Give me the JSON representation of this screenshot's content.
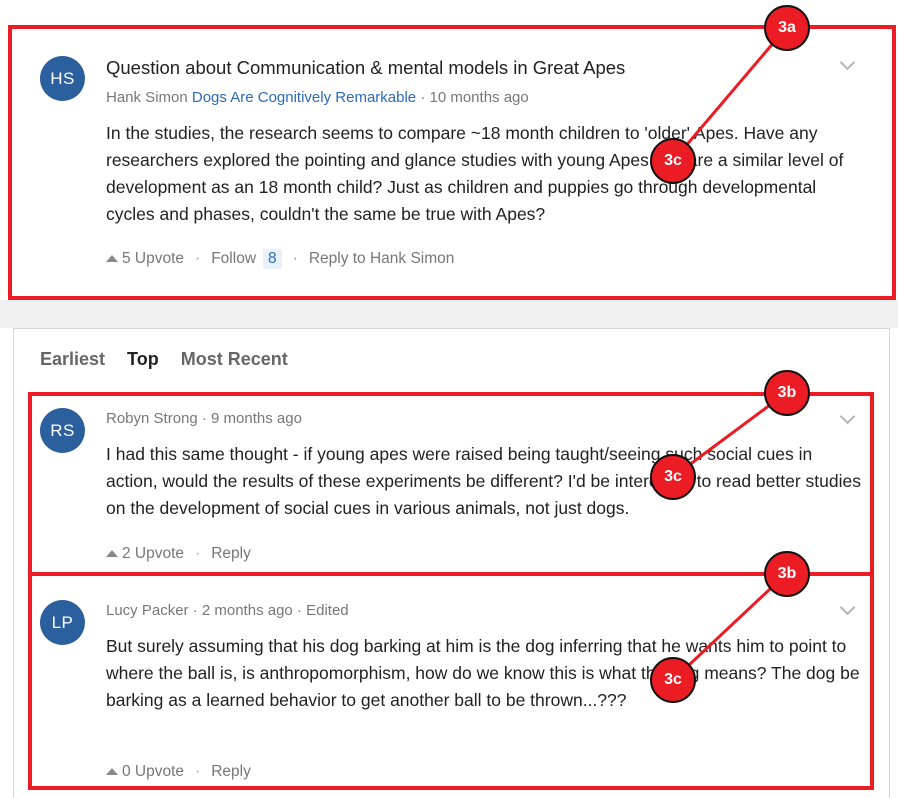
{
  "post": {
    "avatar": "HS",
    "title": "Question about Communication & mental models in Great Apes",
    "author": "Hank Simon",
    "topic": "Dogs Are Cognitively Remarkable",
    "time": "· 10 months ago",
    "body": "In the studies, the research seems to compare ~18 month children to 'older' Apes. Have any researchers explored the pointing and glance studies with young Apes that are a similar level of development as an 18 month child? Just as children and puppies go through developmental cycles and phases, couldn't the same be true with Apes?",
    "upvote_label": "5 Upvote",
    "follow_label": "Follow",
    "follow_count": "8",
    "reply_label": "Reply to Hank Simon"
  },
  "tabs": [
    {
      "label": "Earliest",
      "active": false
    },
    {
      "label": "Top",
      "active": true
    },
    {
      "label": "Most Recent",
      "active": false
    }
  ],
  "comments": [
    {
      "avatar": "RS",
      "meta": "Robyn Strong · 9 months ago",
      "body": "I had this same thought - if young apes were raised being taught/seeing such social cues in action, would the results of these experiments be different? I'd be interested to read better studies on the development of social cues in various animals, not just dogs.",
      "upvote_label": "2 Upvote",
      "reply_label": "Reply"
    },
    {
      "avatar": "LP",
      "meta": "Lucy Packer · 2 months ago · Edited",
      "body": "But surely assuming that his dog barking at him is the dog inferring that he wants him to point to where the ball is, is anthropomorphism, how do we know this is what the dog means? The dog be barking as a learned behavior to get another ball to be thrown...???",
      "upvote_label": "0 Upvote",
      "reply_label": "Reply"
    }
  ],
  "annotations": {
    "post_label": "3a",
    "comment_label": "3b",
    "text_label": "3c",
    "color": "#ec1c24"
  },
  "icons": {
    "upvote": "upvote-arrow-icon",
    "more": "chevron-down-icon"
  }
}
